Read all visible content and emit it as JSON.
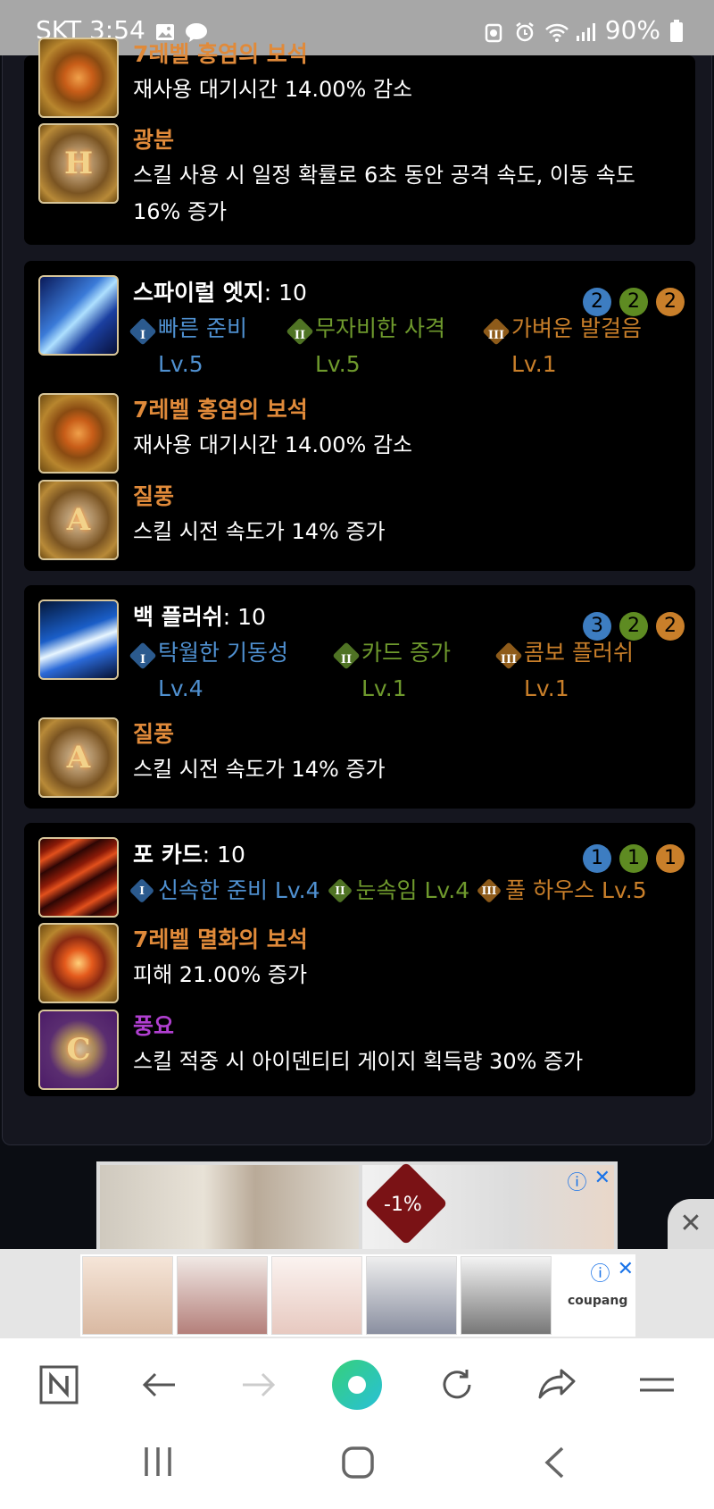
{
  "status_bar": {
    "carrier_time": "SKT 3:54",
    "battery": "90%"
  },
  "block0": {
    "rows": [
      {
        "name": "7레벨 홍염의 보석",
        "desc": "재사용 대기시간 14.00% 감소"
      },
      {
        "name": "광분",
        "desc": "스킬 사용 시 일정 확률로 6초 동안 공격 속도, 이동 속도",
        "desc2": "16% 증가"
      }
    ]
  },
  "skills": [
    {
      "name": "스파이럴 엣지",
      "level": ": 10",
      "badges": [
        "2",
        "2",
        "2"
      ],
      "tripods": [
        {
          "numeral": "I",
          "name": "빠른 준비",
          "lv": "Lv.5"
        },
        {
          "numeral": "II",
          "name": "무자비한 사격",
          "lv": "Lv.5"
        },
        {
          "numeral": "III",
          "name": "가벼운 발걸음",
          "lv": "Lv.1"
        }
      ],
      "rows": [
        {
          "name": "7레벨 홍염의 보석",
          "desc": "재사용 대기시간 14.00% 감소"
        },
        {
          "name": "질풍",
          "desc": "스킬 시전 속도가 14% 증가"
        }
      ]
    },
    {
      "name": "백 플러쉬",
      "level": ": 10",
      "badges": [
        "3",
        "2",
        "2"
      ],
      "tripods": [
        {
          "numeral": "I",
          "name": "탁월한 기동성",
          "lv": "Lv.4"
        },
        {
          "numeral": "II",
          "name": "카드 증가",
          "lv": "Lv.1"
        },
        {
          "numeral": "III",
          "name": "콤보 플러쉬",
          "lv": "Lv.1"
        }
      ],
      "rows": [
        {
          "name": "질풍",
          "desc": "스킬 시전 속도가 14% 증가"
        }
      ]
    },
    {
      "name": "포 카드",
      "level": ": 10",
      "badges": [
        "1",
        "1",
        "1"
      ],
      "tripods": [
        {
          "numeral": "I",
          "name": "신속한 준비 Lv.4"
        },
        {
          "numeral": "II",
          "name": "눈속임 Lv.4"
        },
        {
          "numeral": "III",
          "name": "풀 하우스 Lv.5"
        }
      ],
      "rows": [
        {
          "name": "7레벨 멸화의 보석",
          "desc": "피해 21.00% 증가"
        },
        {
          "name": "풍요",
          "desc": "스킬 적중 시 아이덴티티 게이지 획득량 30% 증가"
        }
      ]
    }
  ],
  "ads": {
    "discount": "-1%",
    "brand": "coupang"
  },
  "colors": {
    "orange": "#e08a3a",
    "purple": "#b03fd0",
    "tripod_blue": "#4f90d0",
    "tripod_green": "#6f9a2d",
    "tripod_orange": "#c97f2a"
  }
}
